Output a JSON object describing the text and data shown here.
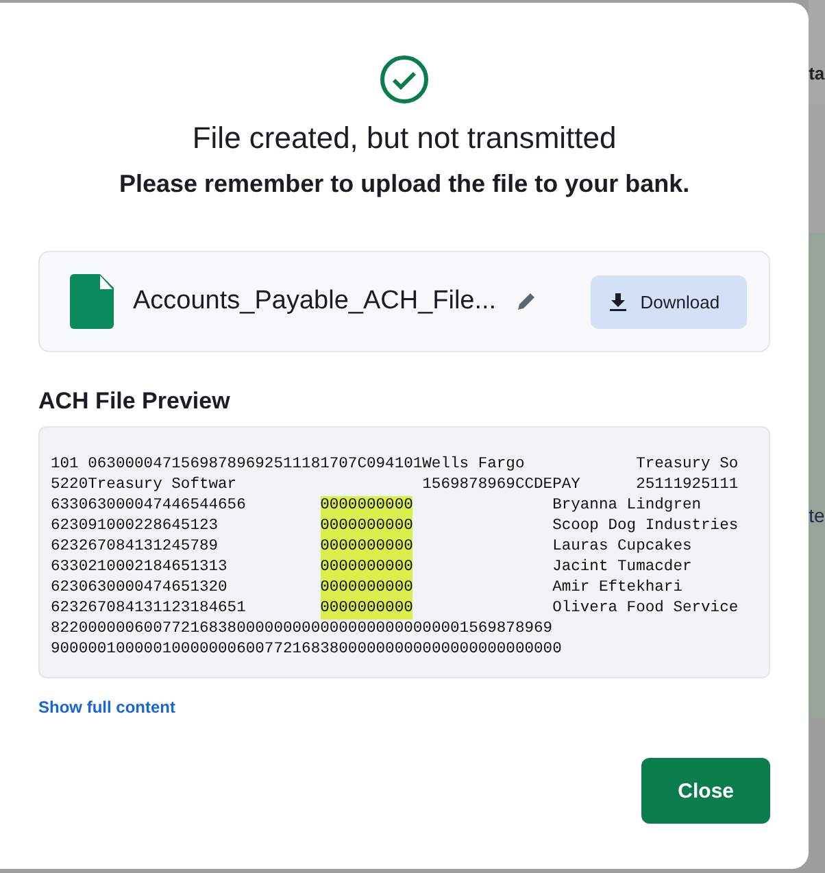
{
  "background": {
    "fragments": [
      "ta",
      "te"
    ]
  },
  "dialog": {
    "title": "File created, but not transmitted",
    "subtitle": "Please remember to upload the file to your bank.",
    "file": {
      "name": "Accounts_Payable_ACH_File...",
      "download_label": "Download"
    },
    "preview": {
      "heading": "ACH File Preview",
      "lines": [
        {
          "kind": "header",
          "parts": [
            "101 06300004715698789692511181707C094101",
            "Wells Fargo",
            "Treasury So"
          ]
        },
        {
          "kind": "batch",
          "parts": [
            "5220Treasury Softwar",
            "1569878969CCDEPAY",
            "25111925111"
          ]
        },
        {
          "kind": "entry",
          "parts": [
            "633063000047446544656",
            "0000000000",
            "Bryanna Lindgren"
          ]
        },
        {
          "kind": "entry",
          "parts": [
            "623091000228645123",
            "0000000000",
            "Scoop Dog Industries"
          ]
        },
        {
          "kind": "entry",
          "parts": [
            "623267084131245789",
            "0000000000",
            "Lauras Cupcakes"
          ]
        },
        {
          "kind": "entry",
          "parts": [
            "6330210002184651313",
            "0000000000",
            "Jacint Tumacder"
          ]
        },
        {
          "kind": "entry",
          "parts": [
            "6230630000474651320",
            "0000000000",
            "Amir Eftekhari"
          ]
        },
        {
          "kind": "entry",
          "parts": [
            "623267084131123184651",
            "0000000000",
            "Olivera Food Service"
          ]
        },
        {
          "kind": "control",
          "parts": [
            "822000000600772168380000000000000000000000001569878969"
          ]
        },
        {
          "kind": "control",
          "parts": [
            "9000001000001000000060077216838000000000000000000000000"
          ]
        }
      ]
    },
    "show_full_label": "Show full content",
    "close_label": "Close"
  }
}
